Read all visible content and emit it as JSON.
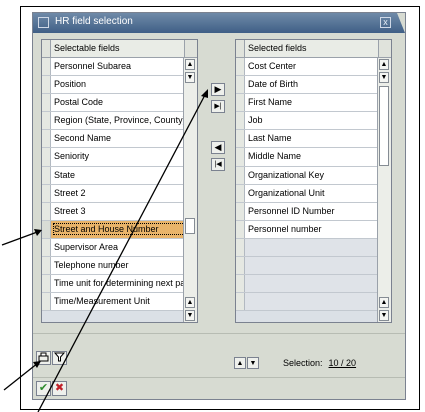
{
  "window": {
    "title": "HR field selection",
    "close_label": "x"
  },
  "left_list": {
    "header": "Selectable fields",
    "items": [
      "Personnel Subarea",
      "Position",
      "Postal Code",
      "Region (State, Province, County)",
      "Second Name",
      "Seniority",
      "State",
      "Street 2",
      "Street 3",
      "Street and House Number",
      "Supervisor Area",
      "Telephone number",
      "Time unit for determining next pay",
      "Time/Measurement Unit"
    ],
    "highlighted_index": 9
  },
  "right_list": {
    "header": "Selected fields",
    "items": [
      "Cost Center",
      "Date of Birth",
      "First Name",
      "Job",
      "Last Name",
      "Middle Name",
      "Organizational Key",
      "Organizational Unit",
      "Personnel ID Number",
      "Personnel number",
      "",
      "",
      "",
      ""
    ]
  },
  "move_buttons": {
    "add": "▶",
    "add_all": "▶|",
    "remove": "◀",
    "remove_all": "|◀"
  },
  "scroll": {
    "up": "▲",
    "down": "▼"
  },
  "selection": {
    "label": "Selection:",
    "value": "10 / 20"
  },
  "footer": {
    "ok": "✔",
    "cancel": "✖"
  },
  "colors": {
    "highlight": "#e9b46a",
    "titlebar": "#3f5f86",
    "ok_green": "#2e8b2e",
    "cancel_red": "#c0202a"
  }
}
